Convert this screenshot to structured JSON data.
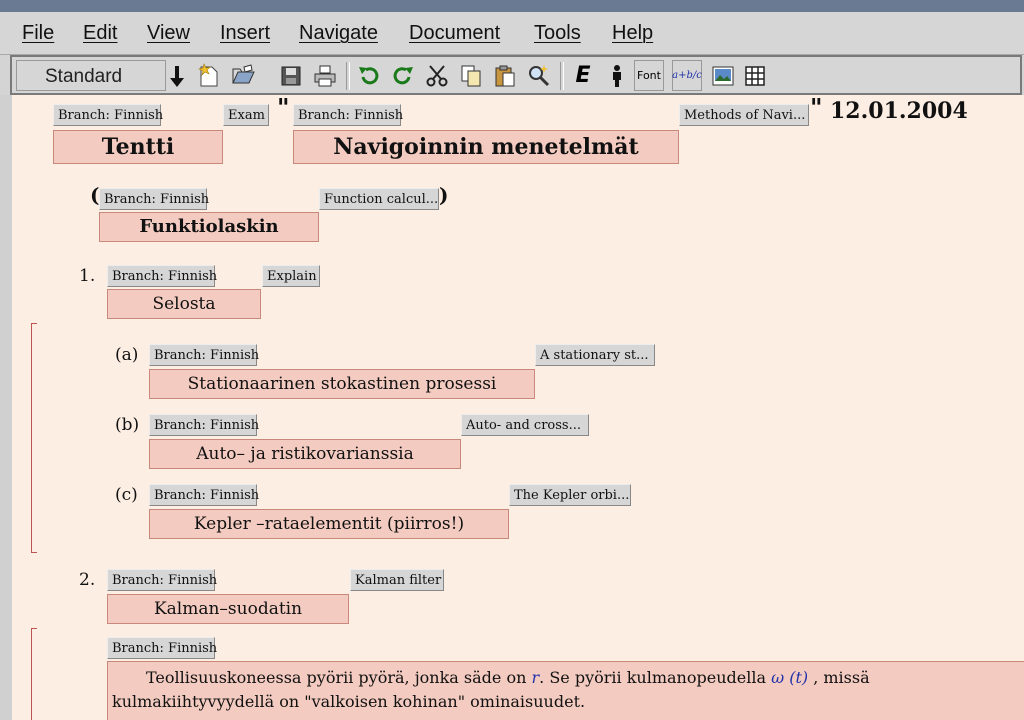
{
  "menu": [
    "File",
    "Edit",
    "View",
    "Insert",
    "Navigate",
    "Document",
    "Tools",
    "Help"
  ],
  "toolbar": {
    "style_value": "Standard",
    "font_label": "Font",
    "frac_label": "a+b/c",
    "e_label": "E"
  },
  "doc": {
    "title": {
      "tag_lang": "Branch: Finnish",
      "tag_exam": "Exam",
      "exam_text": "Tentti",
      "quote_open": "\"",
      "tag_lang2": "Branch: Finnish",
      "tag_methods": "Methods of Navi...",
      "methods_text": "Navigoinnin menetelmät",
      "quote_close": "\"",
      "date": "12.01.2004"
    },
    "subtitle": {
      "paren_open": "(",
      "tag_lang": "Branch: Finnish",
      "tag_func": "Function calcul...",
      "paren_close": ")",
      "text": "Funktiolaskin"
    },
    "q1": {
      "number": "1.",
      "tag_lang": "Branch: Finnish",
      "tag_explain": "Explain",
      "text": "Selosta",
      "items": [
        {
          "label": "(a)",
          "tag_lang": "Branch: Finnish",
          "tag_en": "A stationary st...",
          "text": "Stationaarinen stokastinen prosessi"
        },
        {
          "label": "(b)",
          "tag_lang": "Branch: Finnish",
          "tag_en": "Auto- and cross...",
          "text": "Auto– ja ristikovarianssia"
        },
        {
          "label": "(c)",
          "tag_lang": "Branch: Finnish",
          "tag_en": "The Kepler orbi...",
          "text": "Kepler –rataelementit (piirros!)"
        }
      ]
    },
    "q2": {
      "number": "2.",
      "tag_lang": "Branch: Finnish",
      "tag_kalman": "Kalman filter",
      "text": "Kalman–suodatin",
      "para_tag": "Branch: Finnish",
      "para_line1_a": "Teollisuuskoneessa pyörii pyörä, jonka säde on ",
      "para_r": "r",
      "para_line1_b": ". Se pyörii kulmanopeudella ",
      "para_omega": "ω (t)",
      "para_line1_c": " , missä",
      "para_line2": "kulmakiihtyvyydellä on \"valkoisen kohinan\" ominaisuudet."
    }
  }
}
